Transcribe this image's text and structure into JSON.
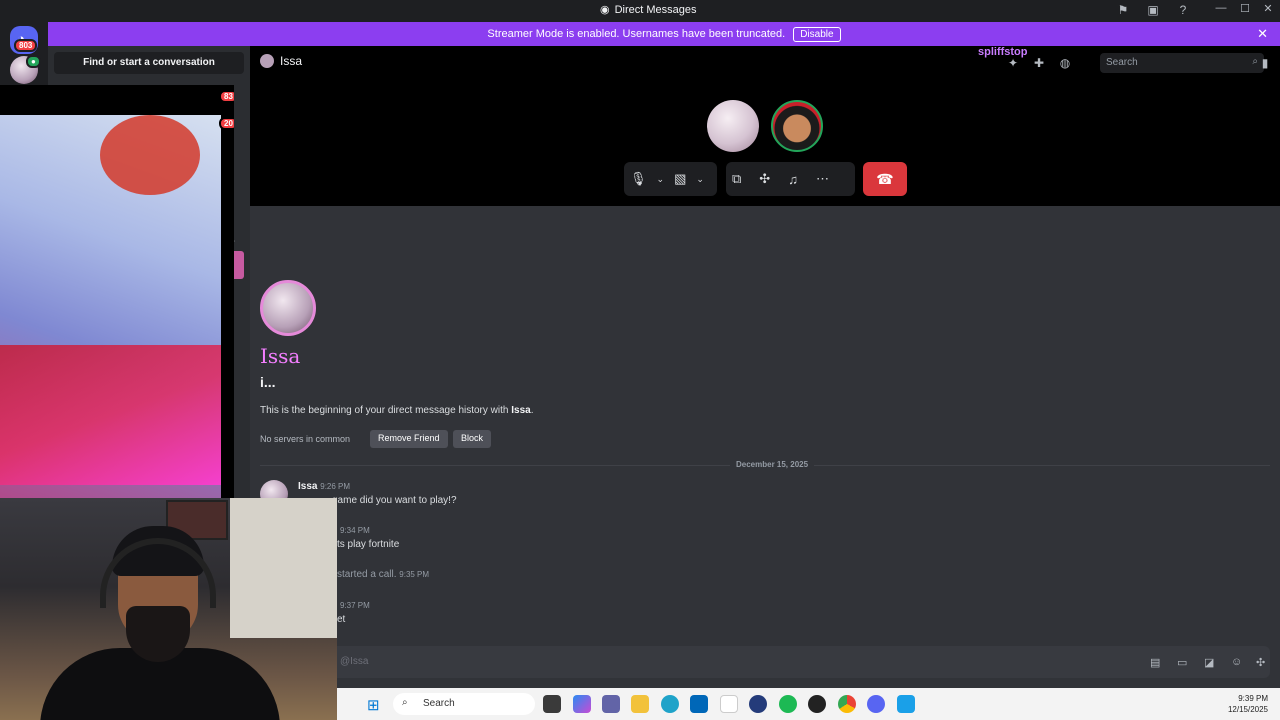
{
  "window": {
    "title": "Direct Messages"
  },
  "banner": {
    "text": "Streamer Mode is enabled. Usernames have been truncated.",
    "disable_label": "Disable"
  },
  "guilds": {
    "home_badge": "803",
    "badge_2": "83",
    "badge_3": "20"
  },
  "sidebar": {
    "find_label": "Find or start a conversation"
  },
  "header": {
    "channel_name": "Issa",
    "streamer_name": "spliffstop",
    "search_placeholder": "Search"
  },
  "profile": {
    "display_name": "Issa",
    "username": "i...",
    "beginning_prefix": "This is the beginning of your direct message history with ",
    "beginning_name": "Issa",
    "beginning_suffix": ".",
    "servers_text": "No servers in common",
    "remove_friend_label": "Remove Friend",
    "block_label": "Block"
  },
  "date_separator": "December 15, 2025",
  "messages": [
    {
      "author": "Issa",
      "time": "9:26 PM",
      "text": "game did you want to play!?"
    },
    {
      "time": "9:34 PM",
      "text": "ts play fortnite"
    },
    {
      "text": "started a call.",
      "time": "9:35 PM"
    },
    {
      "time": "9:37 PM",
      "text": "et"
    }
  ],
  "input": {
    "placeholder": "@Issa"
  },
  "taskbar": {
    "search_label": "Search",
    "time": "9:39 PM",
    "date": "12/15/2025"
  },
  "colors": {
    "banner": "#8c3ef0",
    "hangup": "#da373c",
    "display_name": "#f47fff",
    "streamer_name": "#c97dff"
  }
}
